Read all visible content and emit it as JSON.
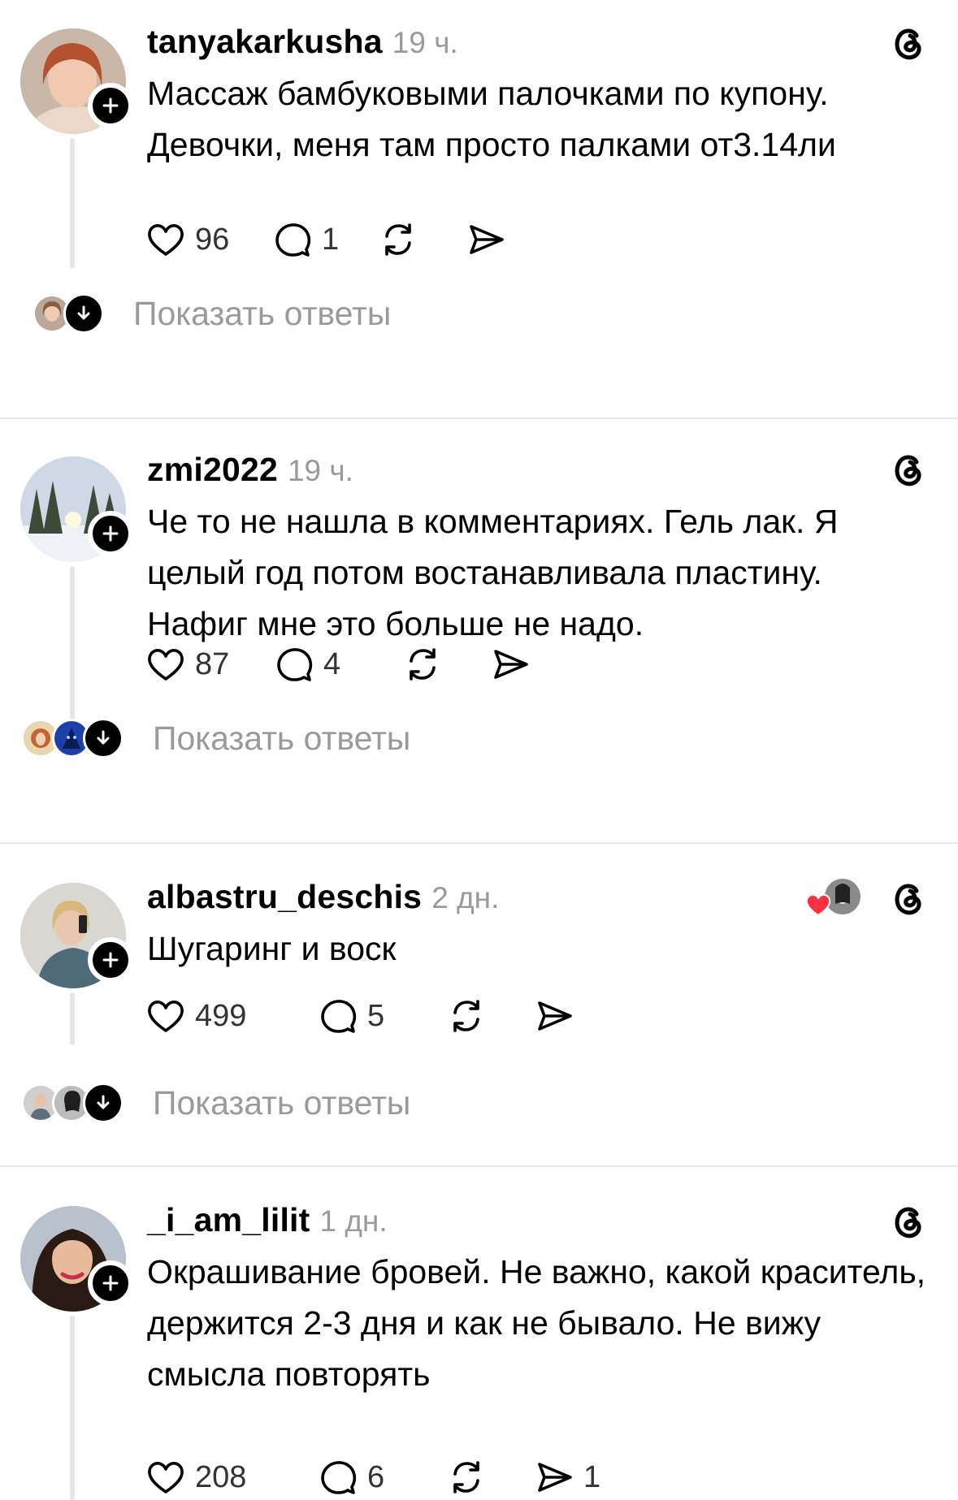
{
  "posts": [
    {
      "username": "tanyakarkusha",
      "time": "19 ч.",
      "text": "Массаж бамбуковыми палочками по купону. Девочки, меня там просто палками от3.14ли",
      "likes": "96",
      "comments": "1",
      "reposts": "",
      "shares": "",
      "show_replies": "Показать ответы"
    },
    {
      "username": "zmi2022",
      "time": "19 ч.",
      "text": "Че то не нашла в комментариях. Гель лак. Я целый год потом востанавливала пластину. Нафиг мне это больше не надо.",
      "likes": "87",
      "comments": "4",
      "reposts": "",
      "shares": "",
      "show_replies": "Показать ответы"
    },
    {
      "username": "albastru_deschis",
      "time": "2 дн.",
      "text": "Шугаринг и воск",
      "likes": "499",
      "comments": "5",
      "reposts": "",
      "shares": "",
      "show_replies": "Показать ответы"
    },
    {
      "username": "_i_am_lilit",
      "time": "1 дн.",
      "text": "Окрашивание бровей. Не важно, какой краситель, держится 2-3 дня и как не бывало. Не вижу смысла повторять",
      "likes": "208",
      "comments": "6",
      "reposts": "",
      "shares": "1",
      "show_replies": ""
    }
  ],
  "icons": {
    "like": "heart-icon",
    "comment": "comment-bubble-icon",
    "repost": "repost-icon",
    "share": "send-icon",
    "app": "threads-logo-icon",
    "follow": "plus-icon",
    "expand": "arrow-down-icon",
    "liked_by_author": "red-heart-icon"
  },
  "colors": {
    "text": "#000000",
    "muted": "#9a9a9a",
    "divider": "#e8e8e8",
    "like_red": "#ff3040"
  }
}
